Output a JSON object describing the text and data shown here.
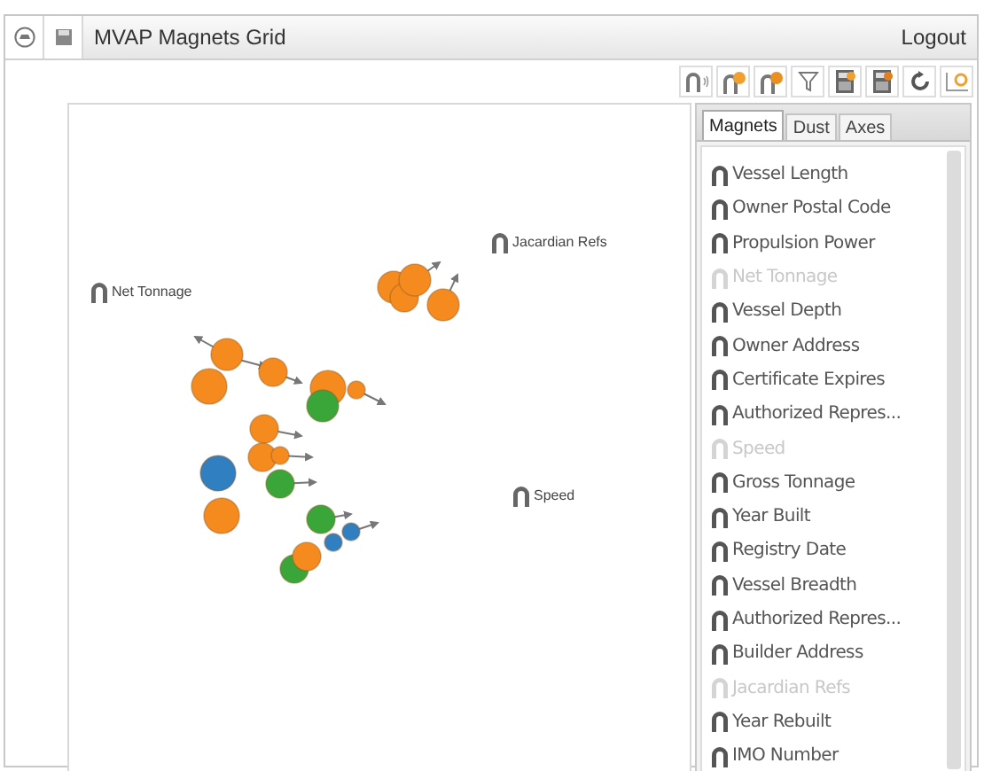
{
  "window": {
    "title": "MVAP Magnets Grid",
    "logout": "Logout"
  },
  "canvas": {
    "magnets": [
      {
        "label": "Jacardian Refs"
      },
      {
        "label": "Net Tonnage"
      },
      {
        "label": "Speed"
      }
    ]
  },
  "panel": {
    "tabs": [
      {
        "label": "Magnets",
        "selected": true
      },
      {
        "label": "Dust",
        "selected": false
      },
      {
        "label": "Axes",
        "selected": false
      }
    ],
    "items": [
      {
        "label": "Vessel Length",
        "disabled": false
      },
      {
        "label": "Owner Postal Code",
        "disabled": false
      },
      {
        "label": "Propulsion Power",
        "disabled": false
      },
      {
        "label": "Net Tonnage",
        "disabled": true
      },
      {
        "label": "Vessel Depth",
        "disabled": false
      },
      {
        "label": "Owner Address",
        "disabled": false
      },
      {
        "label": "Certificate Expires",
        "disabled": false
      },
      {
        "label": "Authorized Repres...",
        "disabled": false
      },
      {
        "label": "Speed",
        "disabled": true
      },
      {
        "label": "Gross Tonnage",
        "disabled": false
      },
      {
        "label": "Year Built",
        "disabled": false
      },
      {
        "label": "Registry Date",
        "disabled": false
      },
      {
        "label": "Vessel Breadth",
        "disabled": false
      },
      {
        "label": "Authorized Repres...",
        "disabled": false
      },
      {
        "label": "Builder Address",
        "disabled": false
      },
      {
        "label": "Jacardian Refs",
        "disabled": true
      },
      {
        "label": "Year Rebuilt",
        "disabled": false
      },
      {
        "label": "IMO Number",
        "disabled": false
      }
    ]
  }
}
